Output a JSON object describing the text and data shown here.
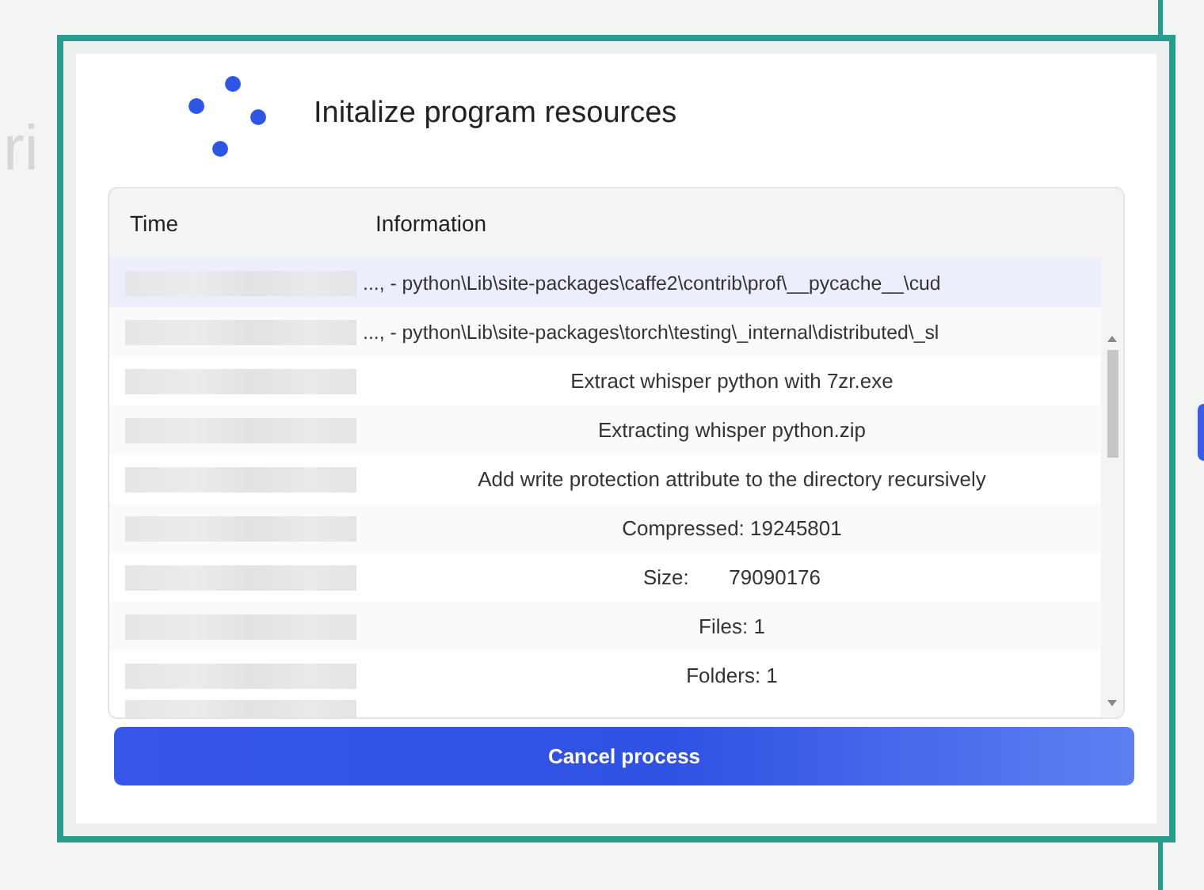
{
  "background": {
    "text": "ri"
  },
  "dialog": {
    "title": "Initalize program resources",
    "table": {
      "columns": [
        "Time",
        "Information"
      ],
      "rows": [
        {
          "information": "..., - python\\Lib\\site-packages\\caffe2\\contrib\\prof\\__pycache__\\cud",
          "selected": true
        },
        {
          "information": "..., - python\\Lib\\site-packages\\torch\\testing\\_internal\\distributed\\_sl",
          "selected": false
        },
        {
          "information": "Extract whisper python with 7zr.exe",
          "selected": false
        },
        {
          "information": "Extracting whisper python.zip",
          "selected": false
        },
        {
          "information": "Add write protection attribute to the directory recursively",
          "selected": false
        },
        {
          "information": "Compressed: 19245801",
          "selected": false
        },
        {
          "information": "Size:       79090176",
          "selected": false
        },
        {
          "information": "Files: 1",
          "selected": false
        },
        {
          "information": "Folders: 1",
          "selected": false
        }
      ]
    },
    "button": "Cancel process"
  }
}
